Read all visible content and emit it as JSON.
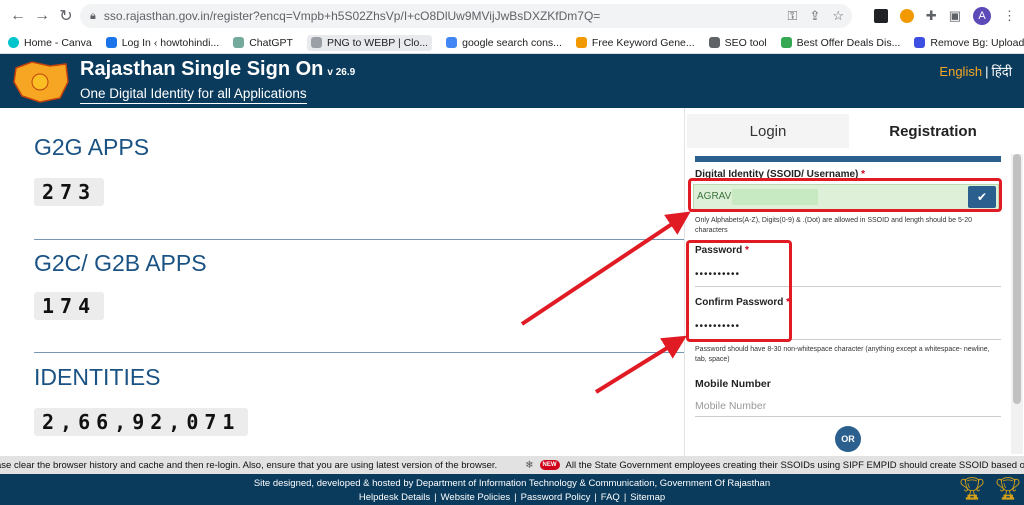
{
  "browser": {
    "url": "sso.rajasthan.gov.in/register?encq=Vmpb+h5S02ZhsVp/I+cO8DlUw9MVijJwBsDXZKfDm7Q=",
    "avatar_letter": "A",
    "bookmarks": [
      {
        "label": "Home - Canva",
        "color": "#00c4cc"
      },
      {
        "label": "Log In ‹ howtohindi...",
        "color": "#1a73e8"
      },
      {
        "label": "ChatGPT",
        "color": "#74aa9c"
      },
      {
        "label": "PNG to WEBP | Clo...",
        "color": "#9aa0a6"
      },
      {
        "label": "google search cons...",
        "color": "#4285f4"
      },
      {
        "label": "Free Keyword Gene...",
        "color": "#f29900"
      },
      {
        "label": "SEO tool",
        "color": "#5f6368"
      },
      {
        "label": "Best Offer Deals Dis...",
        "color": "#34a853"
      },
      {
        "label": "Remove Bg: Upload...",
        "color": "#3c4fe0"
      }
    ]
  },
  "header": {
    "title": "Rajasthan Single Sign On",
    "version": "v 26.9",
    "subtitle": "One Digital Identity for all Applications",
    "lang_en": "English",
    "lang_sep": "|",
    "lang_hi": "हिंदी"
  },
  "stats": [
    {
      "title": "G2G APPS",
      "value": "273"
    },
    {
      "title": "G2C/ G2B APPS",
      "value": "174"
    },
    {
      "title": "IDENTITIES",
      "value": "2,66,92,071"
    }
  ],
  "form": {
    "tab_login": "Login",
    "tab_registration": "Registration",
    "ssoid_label": "Digital Identity (SSOID/ Username)",
    "ssoid_value": "AGRAV",
    "ssoid_help": "Only Alphabets(A-Z), Digits(0-9) & .(Dot) are allowed in SSOID and length should be 5-20 characters",
    "password_label": "Password",
    "password_value": "••••••••••",
    "confirm_label": "Confirm Password",
    "confirm_value": "••••••••••",
    "password_help": "Password should have 8-30 non-whitespace character (anything except a whitespace- newline, tab, space)",
    "mobile_label": "Mobile Number",
    "mobile_placeholder": "Mobile Number",
    "or_label": "OR",
    "required_mark": "*"
  },
  "ticker": {
    "text1": "ase clear the browser history and cache and then re-login. Also, ensure that you are using latest version of the browser.",
    "new_badge": "NEW",
    "text2": "All the State Government employees creating their SSOIDs using SIPF EMPID should create SSOID based o"
  },
  "footer": {
    "line1": "Site designed, developed & hosted by Department of Information Technology & Communication, Government Of Rajasthan",
    "links": [
      "Helpdesk Details",
      "Website Policies",
      "Password Policy",
      "FAQ",
      "Sitemap"
    ],
    "link_divider": "|"
  },
  "colors": {
    "header_bg": "#0b3b5c",
    "accent_blue": "#1a5284",
    "highlight_red": "#e11b23",
    "valid_green": "#dff0d8",
    "lang_orange": "#f6a623"
  }
}
